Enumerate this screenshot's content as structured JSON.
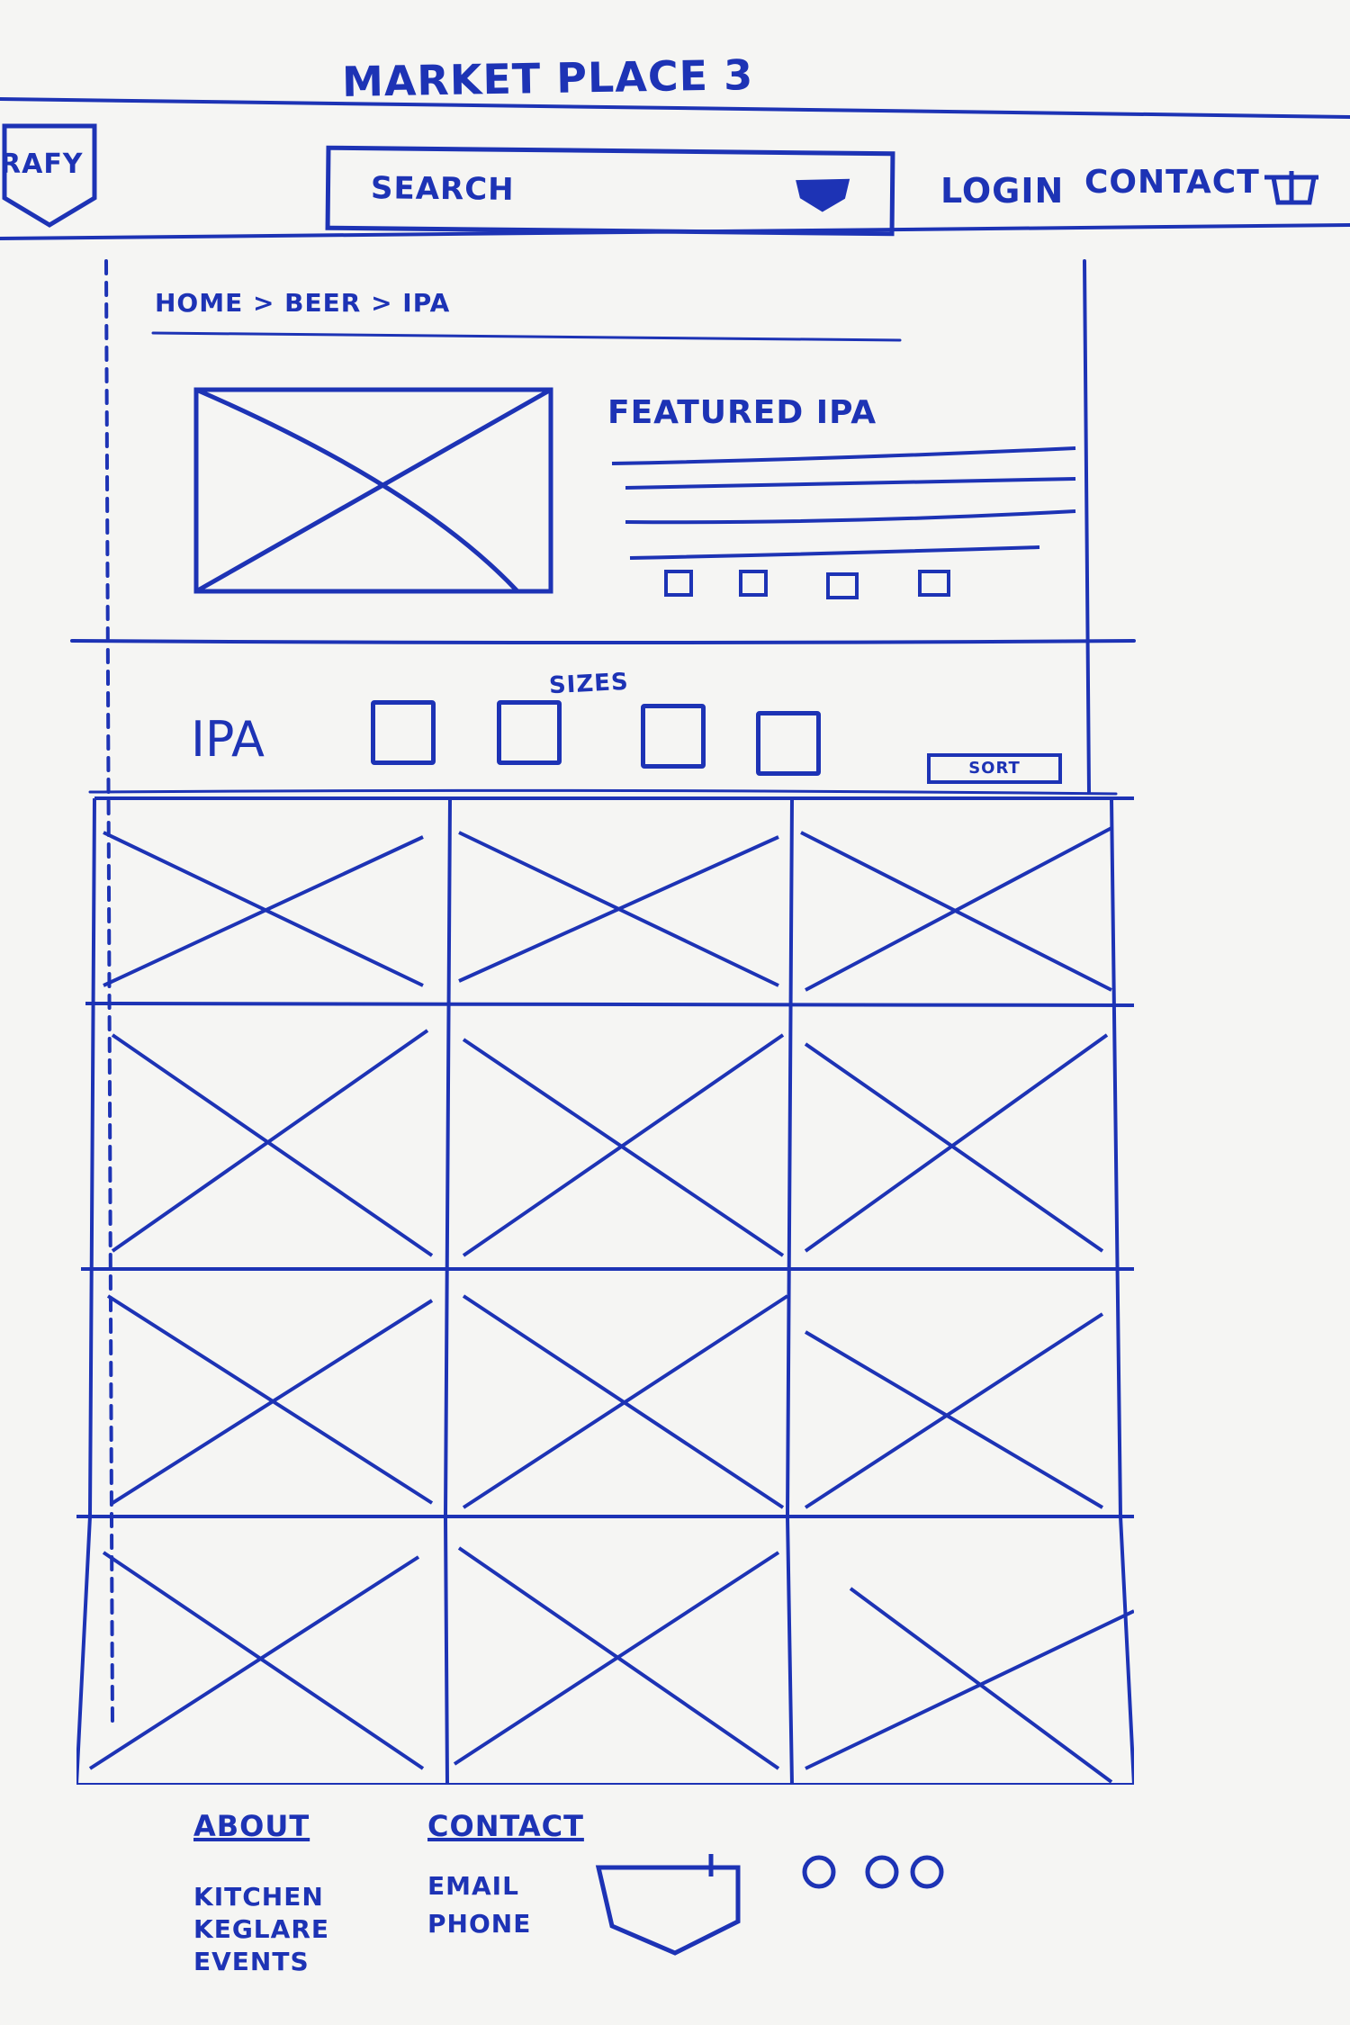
{
  "page": {
    "title": "MARKET PLACE 3"
  },
  "header": {
    "logo_text": "RAFY",
    "search_placeholder": "SEARCH",
    "login_label": "LOGIN",
    "contact_label": "CONTACT"
  },
  "breadcrumb": "HOME > BEER > IPA",
  "featured": {
    "title": "FEATURED IPA"
  },
  "filters": {
    "category": "IPA",
    "sizes_label": "SIZES",
    "sort_label": "SORT"
  },
  "footer": {
    "about_heading": "ABOUT",
    "about_items": [
      "KITCHEN",
      "KEGLARE",
      "EVENTS"
    ],
    "contact_heading": "CONTACT",
    "contact_items": [
      "EMAIL",
      "PHONE"
    ]
  },
  "icons": [
    "search-icon",
    "cart-icon",
    "social-icon"
  ],
  "colors": {
    "ink": "#1d33b5",
    "paper": "#f5f5f3"
  }
}
